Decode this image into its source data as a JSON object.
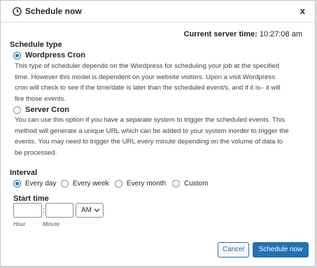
{
  "header": {
    "icon": "clock-icon",
    "title": "Schedule now",
    "close_label": "x"
  },
  "server_time": {
    "label": "Current server time:",
    "value": "10:27:08 am"
  },
  "schedule_type": {
    "title": "Schedule type",
    "options": [
      {
        "label": "Wordpress Cron",
        "selected": true,
        "description_lines": [
          "This type of scheduler depends on the Wordpress for scheduling your job at the specified",
          "time. However this model is dependent on your website visitors. Upon a visit Wordpress",
          "cron will check to see if the time/date is later than the scheduled event/s, and if it is– it will",
          "fire those events."
        ]
      },
      {
        "label": "Server Cron",
        "selected": false,
        "description_lines": [
          "You can use this option if you have a separate system to trigger the scheduled events. This",
          "method will generate a unique URL which can be added to your system inorder to trigger the",
          "events. You may need to trigger the URL every minute depending on the volume of data to",
          "be processed."
        ]
      }
    ]
  },
  "interval": {
    "title": "Interval",
    "options": [
      {
        "label": "Every day",
        "selected": true
      },
      {
        "label": "Every week",
        "selected": false
      },
      {
        "label": "Every month",
        "selected": false
      },
      {
        "label": "Custom",
        "selected": false
      }
    ]
  },
  "start_time": {
    "title": "Start time",
    "hour_value": "",
    "minute_value": "",
    "separator": ":",
    "ampm": "AM",
    "hour_hint": "Hour",
    "minute_hint": "Minute"
  },
  "footer": {
    "cancel_label": "Cancel",
    "submit_label": "Schedule now"
  },
  "colors": {
    "accent": "#2271b1"
  }
}
